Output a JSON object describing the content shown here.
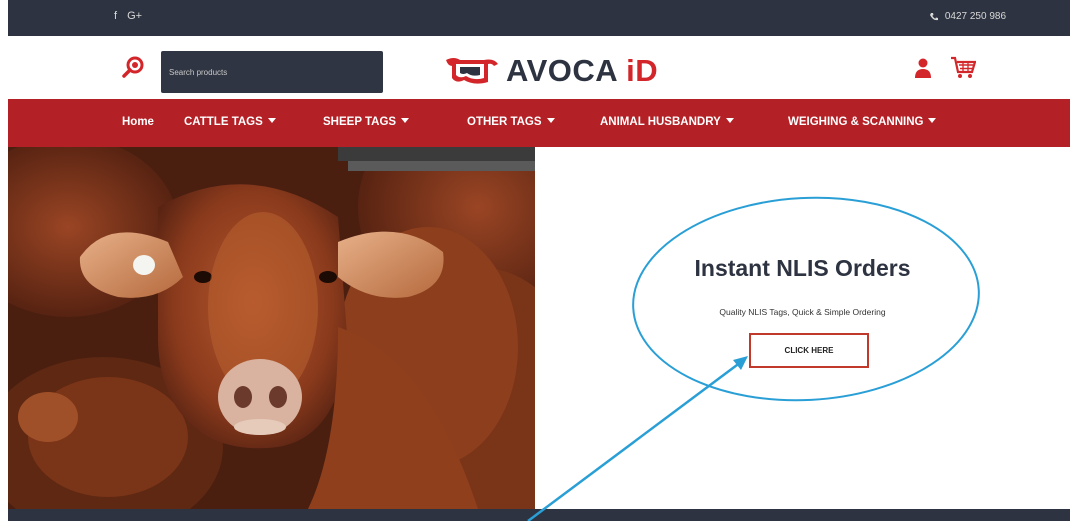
{
  "topbar": {
    "social": [
      {
        "name": "facebook-icon",
        "glyph": "f"
      },
      {
        "name": "google-plus-icon",
        "glyph": "G+"
      }
    ],
    "phone": "0427 250 986"
  },
  "search": {
    "placeholder": "Search products"
  },
  "logo": {
    "main": "AVOCA ",
    "accent": "iD"
  },
  "nav": {
    "items": [
      {
        "label": "Home",
        "dropdown": false
      },
      {
        "label": "CATTLE TAGS",
        "dropdown": true
      },
      {
        "label": "SHEEP TAGS",
        "dropdown": true
      },
      {
        "label": "OTHER TAGS",
        "dropdown": true
      },
      {
        "label": "ANIMAL HUSBANDRY",
        "dropdown": true
      },
      {
        "label": "WEIGHING & SCANNING",
        "dropdown": true
      }
    ]
  },
  "hero": {
    "title": "Instant NLIS Orders",
    "subtitle": "Quality NLIS Tags, Quick & Simple Ordering",
    "cta_label": "CLICK HERE"
  },
  "colors": {
    "topbar": "#2d3340",
    "nav": "#b32025",
    "accent": "#d3262b",
    "annotation": "#2a9fd6"
  }
}
